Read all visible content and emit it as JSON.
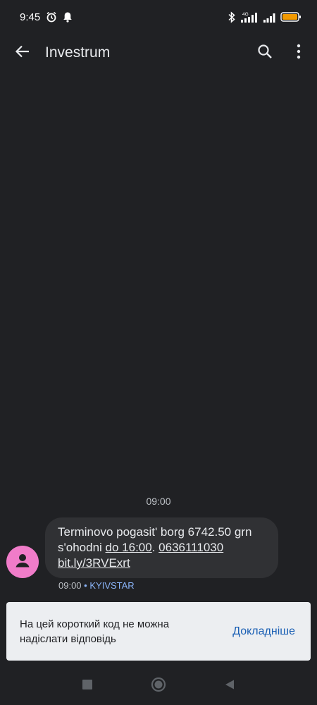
{
  "status_bar": {
    "time": "9:45",
    "icons": [
      "alarm-icon",
      "notification-bell-icon",
      "bluetooth-icon",
      "signal-4g-icon",
      "signal-icon",
      "battery-icon"
    ],
    "network": "4G",
    "battery_color": "#f29900"
  },
  "app_bar": {
    "title": "Investrum",
    "icons": [
      "back-arrow-icon",
      "search-icon",
      "more-vert-icon"
    ]
  },
  "conversation": {
    "date_separator": "09:00",
    "messages": [
      {
        "text_part1": "Terminovo pogasit' borg 6742.50 grn s'ohodni ",
        "link1": "do 16:00",
        "text_part2": ". ",
        "link2": "0636111030",
        "link3": "bit.ly/3RVExrt",
        "time": "09:00",
        "separator": "•",
        "carrier": "KYIVSTAR"
      }
    ],
    "avatar_color": "#f07cc9"
  },
  "info_banner": {
    "text": "На цей короткий код не можна надіслати відповідь",
    "link": "Докладніше"
  },
  "nav_bar": {
    "icons": [
      "recent-apps-icon",
      "home-icon",
      "back-icon"
    ]
  },
  "colors": {
    "background": "#202124",
    "bubble": "#303134",
    "accent": "#8ab4f8",
    "banner_link": "#1a5fb4"
  }
}
